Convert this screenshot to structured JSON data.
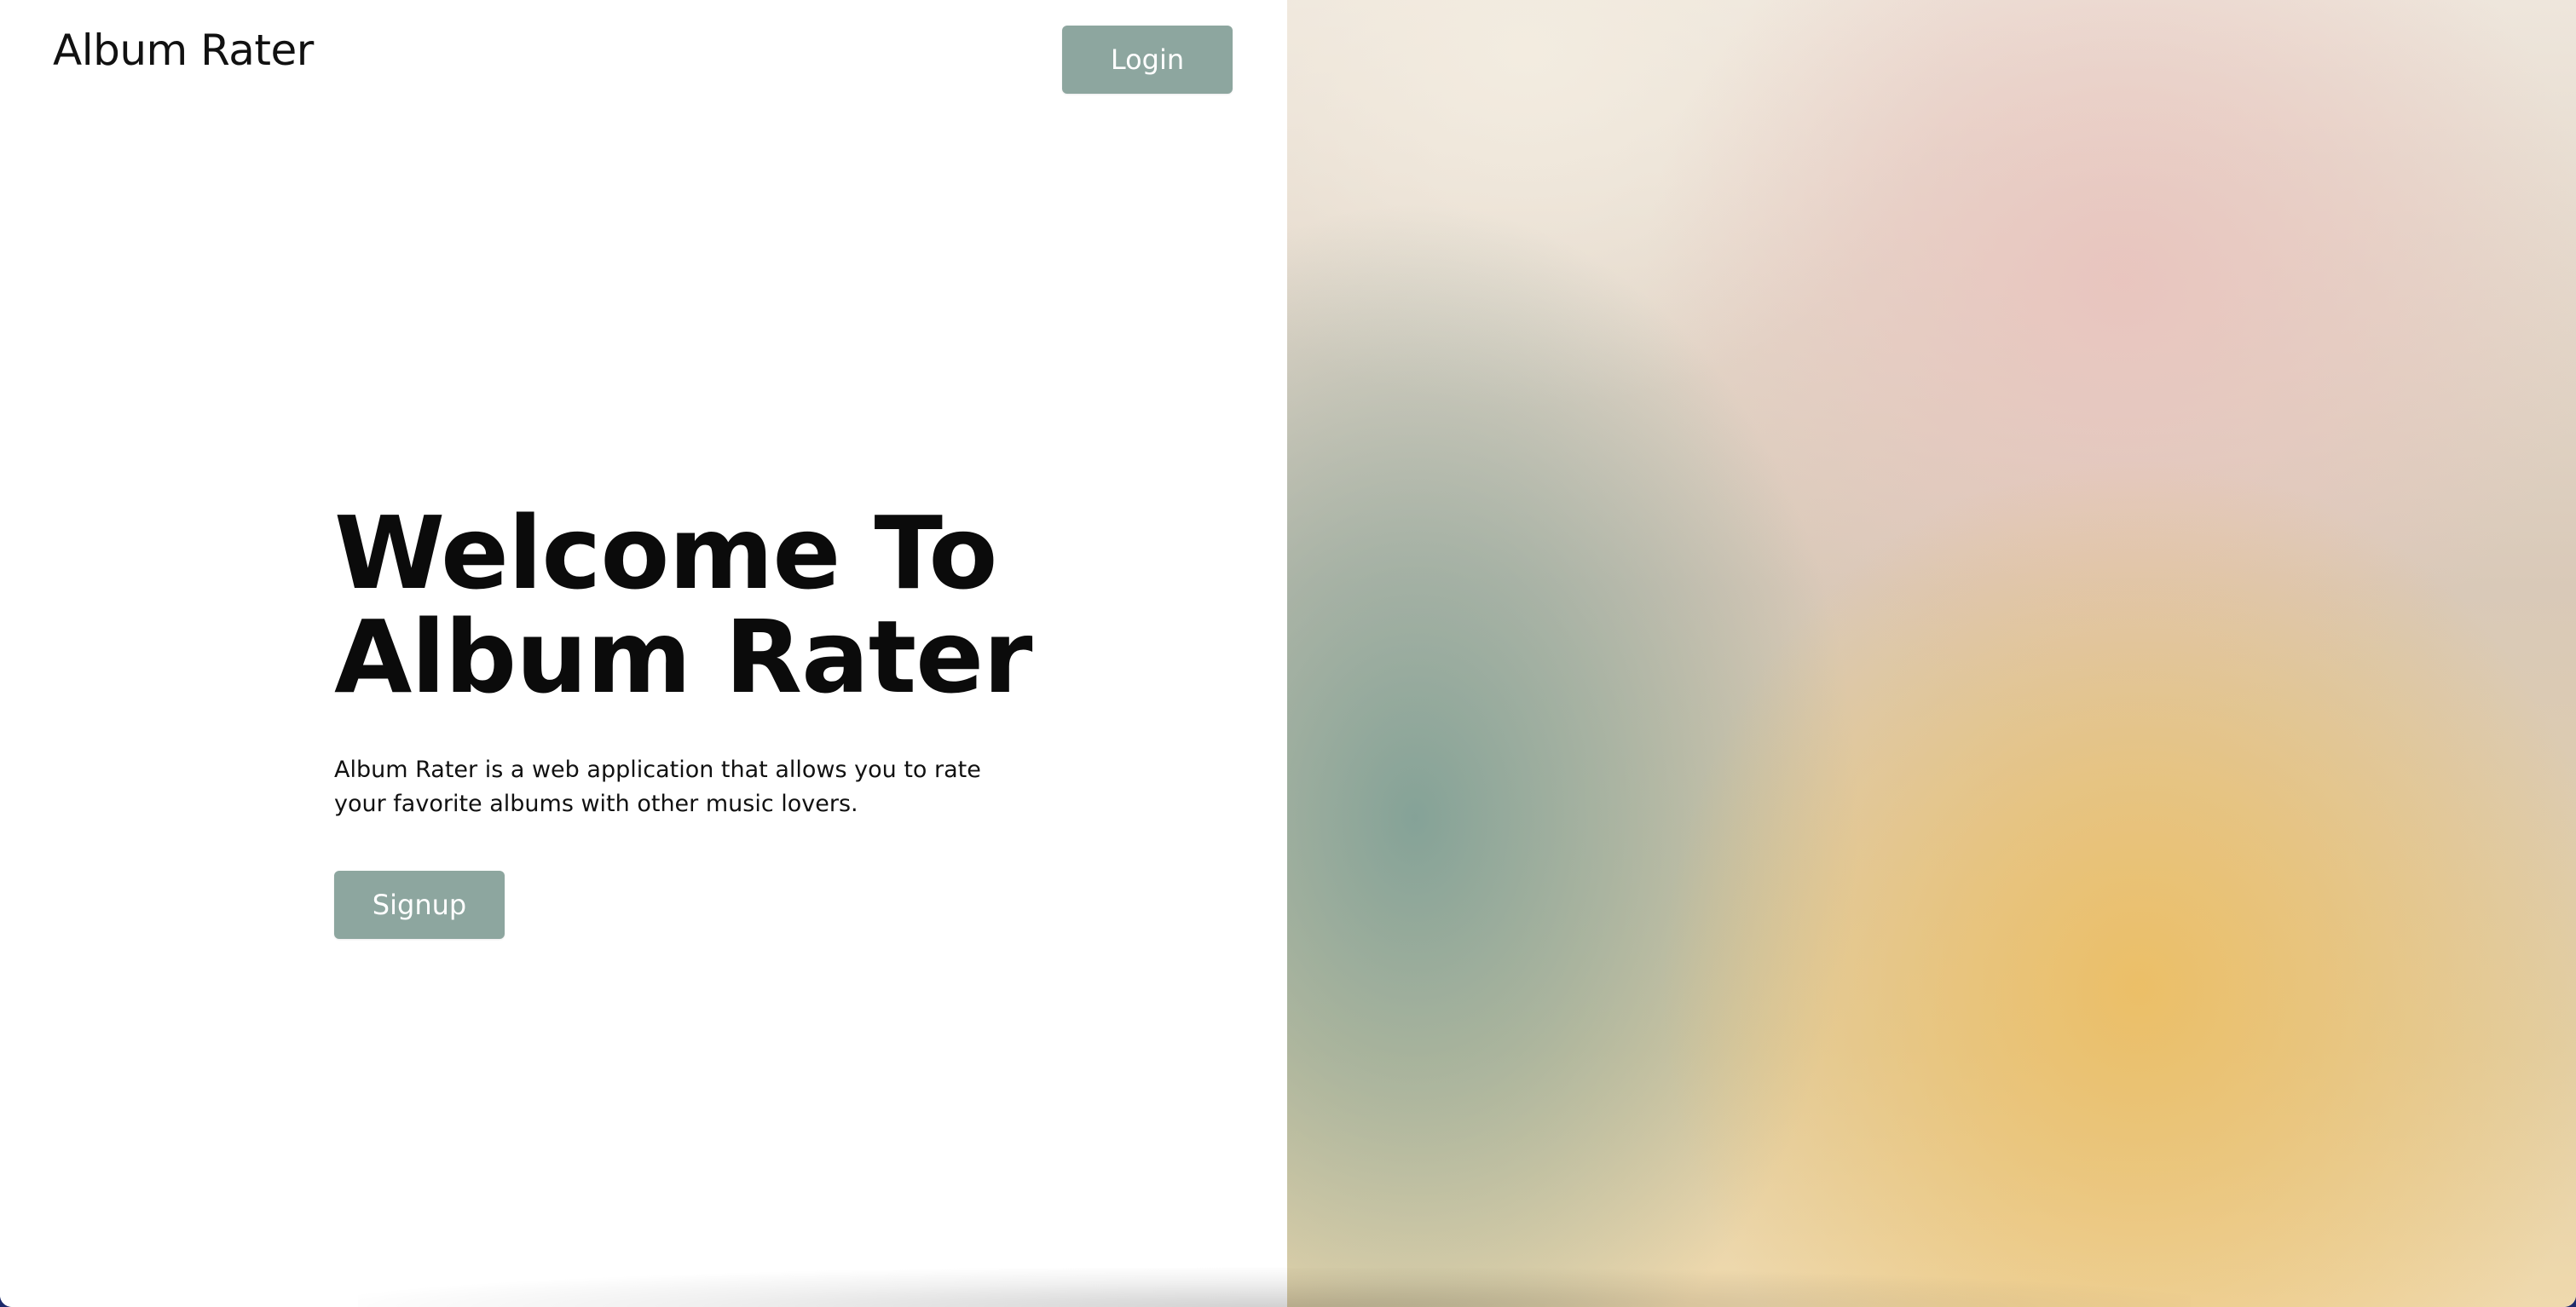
{
  "header": {
    "brand": "Album Rater",
    "login_label": "Login"
  },
  "hero": {
    "title_line1": "Welcome To",
    "title_line2": "Album Rater",
    "description": "Album Rater is a web application that allows you to rate your favorite albums with other music lovers.",
    "signup_label": "Signup"
  },
  "colors": {
    "button_bg": "#8da69f",
    "button_text": "#ffffff",
    "text": "#111111",
    "art_sage": "#80a096",
    "art_pink": "#e9c4be",
    "art_gold": "#ecbe64",
    "art_cream": "#f3ece0"
  }
}
